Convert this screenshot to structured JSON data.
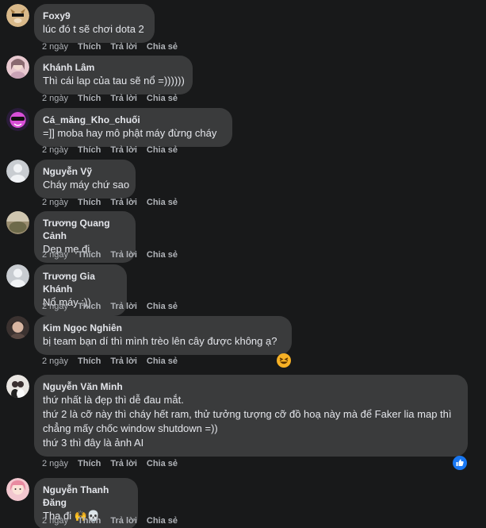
{
  "actions": {
    "like": "Thích",
    "reply": "Trả lời",
    "share": "Chia sẻ"
  },
  "comments": [
    {
      "author": "Foxy9",
      "lines": [
        "lúc đó t sẽ chơi dota 2"
      ],
      "time": "2 ngày"
    },
    {
      "author": "Khánh Lâm",
      "lines": [
        "Thì cái lap của tau sẽ nổ =))))))"
      ],
      "time": "2 ngày"
    },
    {
      "author": "Cá_măng_Kho_chuối",
      "lines": [
        "=]] moba hay mô phật máy đừng cháy"
      ],
      "time": "2 ngày"
    },
    {
      "author": "Nguyễn Vỹ",
      "lines": [
        "Cháy máy chứ sao"
      ],
      "time": "2 ngày"
    },
    {
      "author": "Trương Quang Cảnh",
      "lines": [
        "Dẹp mẹ đi"
      ],
      "time": "2 ngày"
    },
    {
      "author": "Trương Gia Khánh",
      "lines": [
        "Nổ máy :))"
      ],
      "time": "2 ngày"
    },
    {
      "author": "Kim Ngọc Nghiên",
      "lines": [
        "bị team bạn dí thì mình trèo lên cây được không ạ?"
      ],
      "time": "2 ngày"
    },
    {
      "author": "Nguyễn Văn Minh",
      "lines": [
        "thứ nhất là đẹp thì dễ đau mắt.",
        "thứ 2 là cỡ này thì cháy hết ram, thử tưởng tượng cỡ đồ hoạ này mà để Faker lia map thì",
        "chẳng mấy chốc window shutdown =))",
        "thứ 3 thì đây là ảnh AI"
      ],
      "time": "2 ngày"
    },
    {
      "author": "Nguyễn Thanh Đăng",
      "lines": [
        "Tha đi 🙌💀"
      ],
      "time": "2 ngày"
    }
  ],
  "colors": {
    "background": "#18191a",
    "bubble": "#3a3b3c",
    "text": "#e4e6eb",
    "muted": "#b0b3b8",
    "like_blue": "#1877f2"
  }
}
